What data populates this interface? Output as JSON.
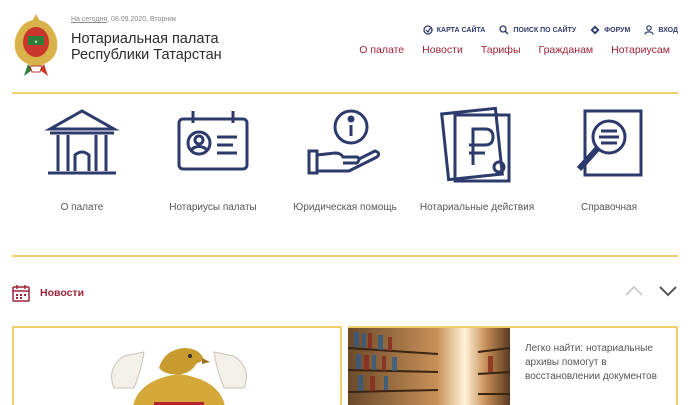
{
  "header": {
    "today_label": "На сегодня",
    "date": ", 08.09.2020, Вторник",
    "org_line1": "Нотариальная палата",
    "org_line2": "Республики Татарстан"
  },
  "utility_links": [
    {
      "label": "КАРТА САЙТА",
      "icon": "sitemap-icon"
    },
    {
      "label": "ПОИСК ПО САЙТУ",
      "icon": "search-icon"
    },
    {
      "label": "ФОРУМ",
      "icon": "forum-icon"
    },
    {
      "label": "ВХОД",
      "icon": "user-icon"
    }
  ],
  "nav": [
    "О палате",
    "Новости",
    "Тарифы",
    "Гражданам",
    "Нотариусам"
  ],
  "services": [
    {
      "label": "О палате",
      "icon": "building-icon"
    },
    {
      "label": "Нотариусы палаты",
      "icon": "id-card-icon"
    },
    {
      "label": "Юридическая помощь",
      "icon": "info-hand-icon"
    },
    {
      "label": "Нотариальные действия",
      "icon": "ruble-documents-icon"
    },
    {
      "label": "Справочная",
      "icon": "magnifier-document-icon"
    }
  ],
  "news": {
    "title": "Новости",
    "item2_caption": "Легко найти: нотариальные архивы помогут в восстановлении документов"
  },
  "colors": {
    "accent": "#a0223a",
    "navy": "#2d3a6c",
    "gold": "#f0cf6a"
  }
}
